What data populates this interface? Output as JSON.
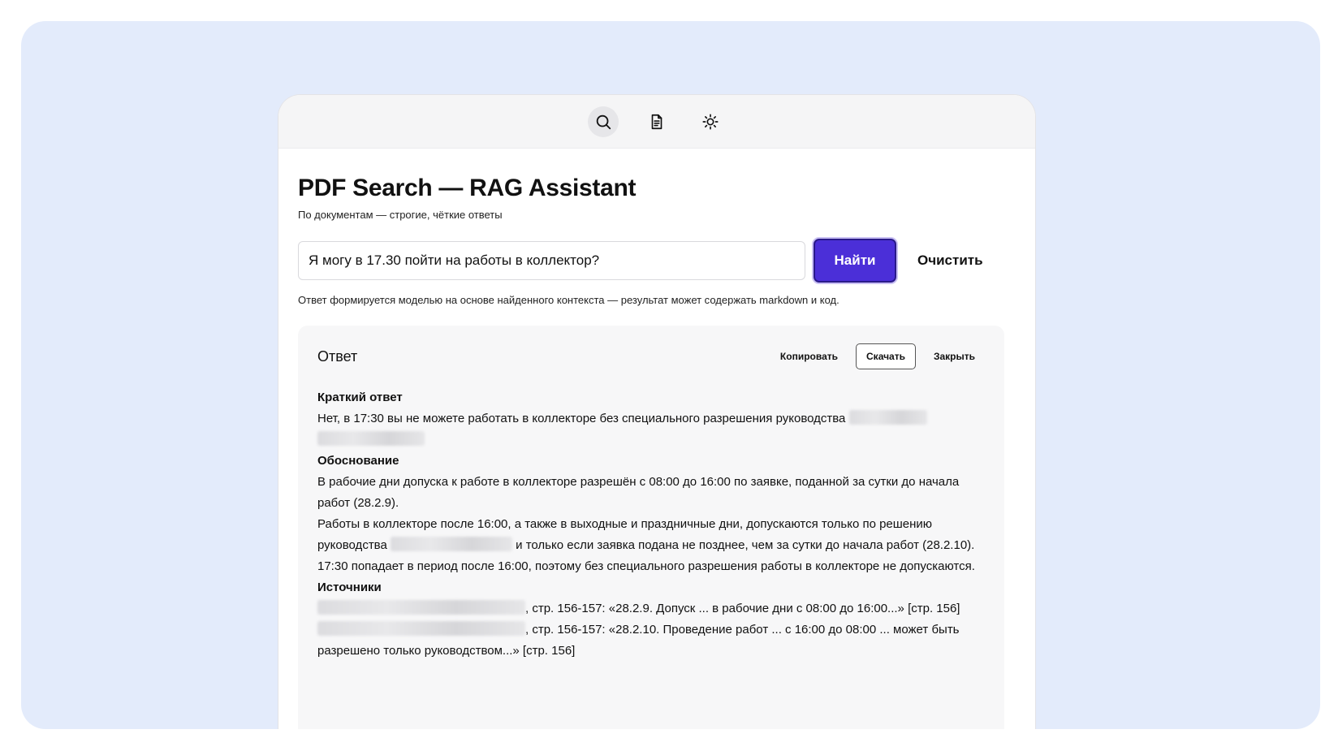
{
  "toolbar": {
    "icons": [
      "search-icon",
      "document-icon",
      "sun-icon"
    ]
  },
  "header": {
    "title": "PDF Search — RAG Assistant",
    "subtitle": "По документам — строгие, чёткие ответы"
  },
  "search": {
    "value": "Я могу в 17.30 пойти на работы в коллектор?",
    "find_label": "Найти",
    "clear_label": "Очистить",
    "hint": "Ответ формируется моделью на основе найденного контекста — результат может содержать markdown и код."
  },
  "answer": {
    "title": "Ответ",
    "copy_label": "Копировать",
    "download_label": "Скачать",
    "close_label": "Закрыть",
    "short_heading": "Краткий ответ",
    "short_text": "Нет, в 17:30 вы не можете работать в коллекторе без специального разрешения руководства",
    "reason_heading": "Обоснование",
    "reason_1": "В рабочие дни допуска к работе в коллекторе разрешён с 08:00 до 16:00 по заявке, поданной за сутки до начала работ (28.2.9).",
    "reason_2a": "Работы в коллекторе после 16:00, а также в выходные и праздничные дни, допускаются только по решению руководства",
    "reason_2b": "и только если заявка подана не позднее, чем за сутки до начала работ (28.2.10).",
    "reason_3": "17:30 попадает в период после 16:00, поэтому без специального разрешения работы в коллекторе не допускаются.",
    "sources_heading": "Источники",
    "source_1": ", стр. 156-157: «28.2.9. Допуск ... в рабочие дни с 08:00 до 16:00...» [стр. 156]",
    "source_2": ", стр. 156-157: «28.2.10. Проведение работ ... с 16:00 до 08:00 ... может быть разрешено только руководством...» [стр. 156]"
  }
}
